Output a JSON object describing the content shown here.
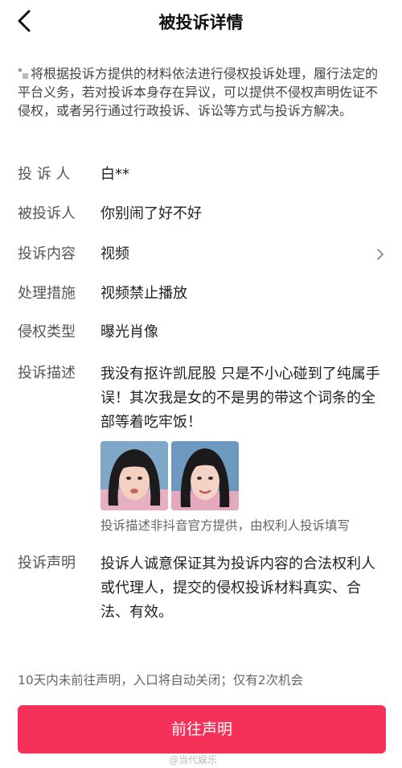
{
  "header": {
    "title": "被投诉详情"
  },
  "notice": {
    "text": "将根据投诉方提供的材料依法进行侵权投诉处理，履行法定的平台义务，若对投诉本身存在异议，可以提供不侵权声明佐证不侵权，或者另行通过行政投诉、诉讼等方式与投诉方解决。"
  },
  "details": {
    "complainant": {
      "label": "投 诉 人",
      "value": "白**"
    },
    "respondent": {
      "label": "被投诉人",
      "value": "你别闹了好不好"
    },
    "content": {
      "label": "投诉内容",
      "value": "视频"
    },
    "measure": {
      "label": "处理措施",
      "value": "视频禁止播放"
    },
    "infringement_type": {
      "label": "侵权类型",
      "value": "曝光肖像"
    },
    "description": {
      "label": "投诉描述",
      "value": "我没有抠许凯屁股 只是不小心碰到了纯属手误！其次我是女的不是男的带这个词条的全部等着吃牢饭！"
    },
    "statement": {
      "label": "投诉声明",
      "value": "投诉人诚意保证其为投诉内容的合法权利人或代理人，提交的侵权投诉材料真实、合法、有效。"
    }
  },
  "evidence": {
    "note": "投诉描述非抖音官方提供，由权利人投诉填写"
  },
  "footer": {
    "note": "10天内未前往声明，入口将自动关闭；仅有2次机会",
    "cta_label": "前往声明"
  },
  "watermark": {
    "text": "@当代娱乐"
  },
  "colors": {
    "accent": "#f5315a"
  }
}
